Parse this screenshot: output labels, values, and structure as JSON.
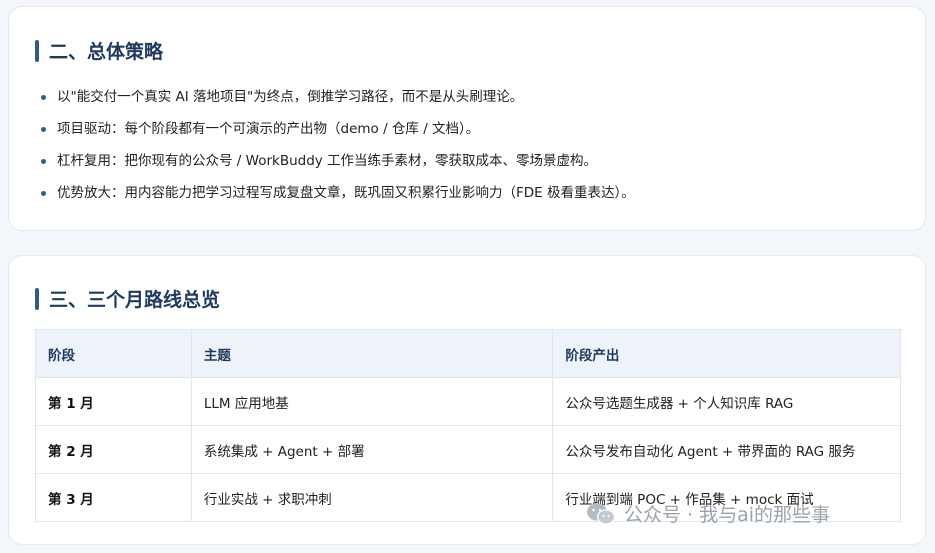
{
  "section2": {
    "title": "二、总体策略",
    "bullets": [
      "以\"能交付一个真实 AI 落地项目\"为终点，倒推学习路径，而不是从头刷理论。",
      "项目驱动：每个阶段都有一个可演示的产出物（demo / 仓库 / 文档）。",
      "杠杆复用：把你现有的公众号 / WorkBuddy 工作当练手素材，零获取成本、零场景虚构。",
      "优势放大：用内容能力把学习过程写成复盘文章，既巩固又积累行业影响力（FDE 极看重表达）。"
    ]
  },
  "section3": {
    "title": "三、三个月路线总览",
    "headers": [
      "阶段",
      "主题",
      "阶段产出"
    ],
    "rows": [
      [
        "第 1 月",
        "LLM 应用地基",
        "公众号选题生成器 + 个人知识库 RAG"
      ],
      [
        "第 2 月",
        "系统集成 + Agent + 部署",
        "公众号发布自动化 Agent + 带界面的 RAG 服务"
      ],
      [
        "第 3 月",
        "行业实战 + 求职冲刺",
        "行业端到端 POC + 作品集 + mock 面试"
      ]
    ]
  },
  "watermark": {
    "text": "公众号 · 我与ai的那些事",
    "icon": "wechat-icon"
  },
  "colors": {
    "accent": "#2f5b8f",
    "heading": "#1e3a5f",
    "table_header_bg": "#eef3fa"
  }
}
